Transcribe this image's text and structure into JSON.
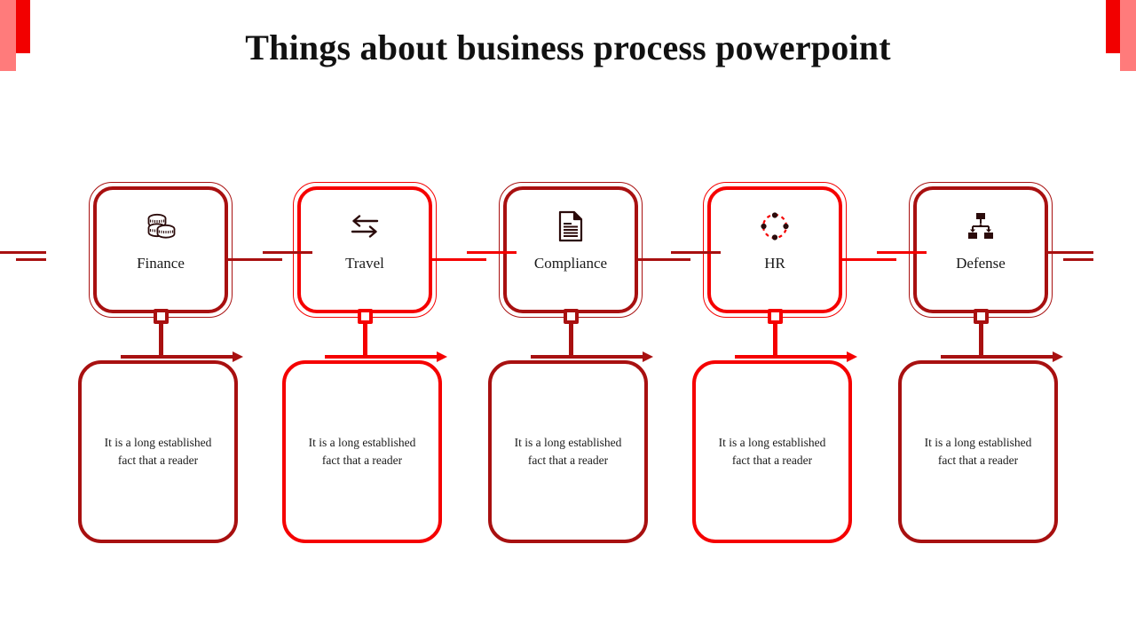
{
  "slide": {
    "title": "Things about business process powerpoint",
    "background": "#ffffff"
  },
  "decor": {
    "corner_top_left_pink": "#ff7b7b",
    "corner_top_left_red": "#f20000",
    "corner_top_right_red": "#f20000",
    "corner_top_right_pink": "#ff7b7b"
  },
  "colors": {
    "dark_red": "#a81010",
    "bright_red": "#f50000",
    "text": "#1a1a1a"
  },
  "columns": [
    {
      "label": "Finance",
      "icon": "coins-icon",
      "accent": "#a81010",
      "body": "It is a long established fact that a reader"
    },
    {
      "label": "Travel",
      "icon": "exchange-arrows-icon",
      "accent": "#f50000",
      "body": "It is a long established fact that a reader"
    },
    {
      "label": "Compliance",
      "icon": "document-icon",
      "accent": "#a81010",
      "body": "It is a long established fact that a reader"
    },
    {
      "label": "HR",
      "icon": "cycle-nodes-icon",
      "accent": "#f50000",
      "body": "It is a long established fact that a reader"
    },
    {
      "label": "Defense",
      "icon": "hierarchy-icon",
      "accent": "#a81010",
      "body": "It is a long established fact that a reader"
    }
  ]
}
